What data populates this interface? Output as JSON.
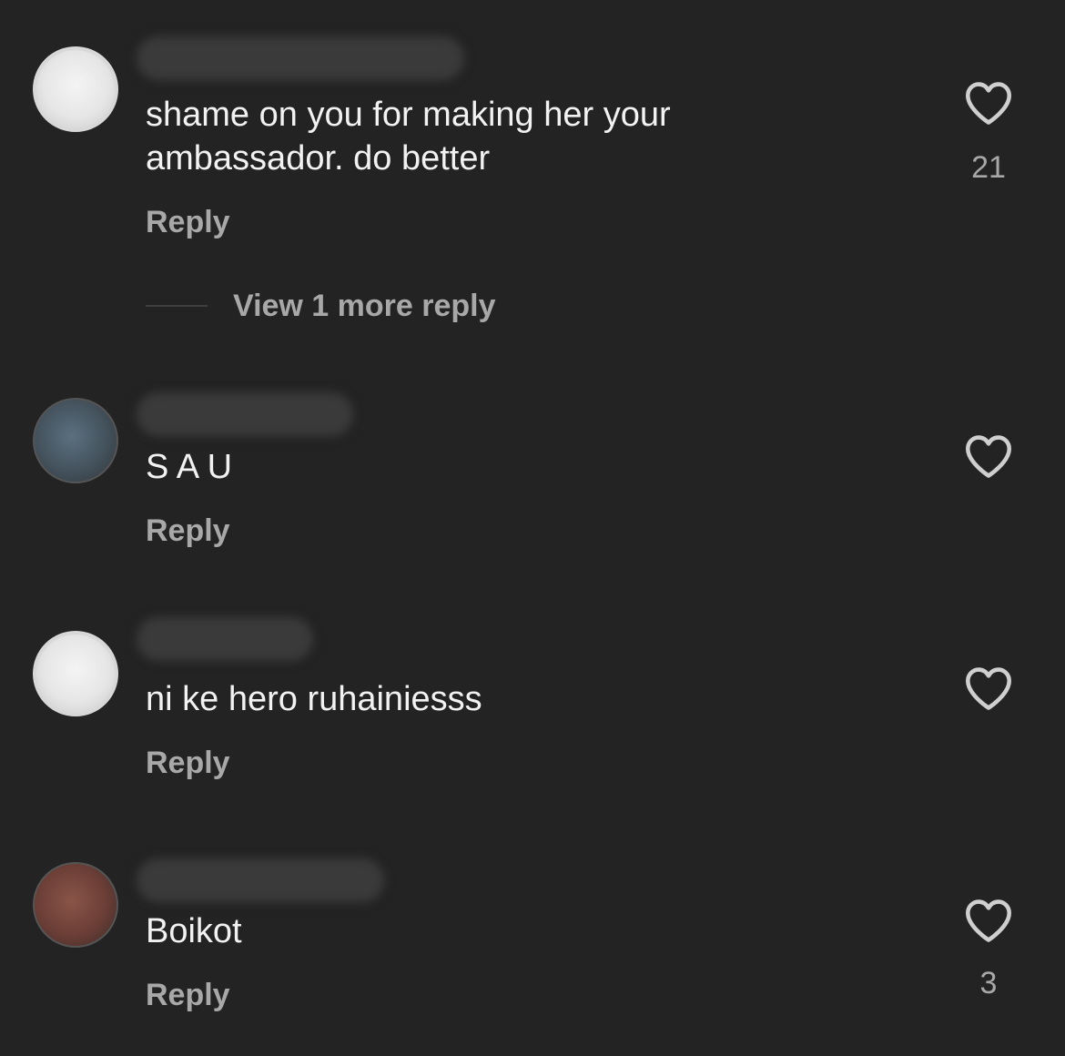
{
  "comments": [
    {
      "text": "shame on you for making her your\nambassador. do better",
      "reply_label": "Reply",
      "like_count": "21",
      "view_replies_label": "View 1 more reply",
      "avatar": "light"
    },
    {
      "text": "S A U",
      "reply_label": "Reply",
      "like_count": "",
      "avatar": "blue"
    },
    {
      "text": "ni ke hero ruhainiesss",
      "reply_label": "Reply",
      "like_count": "",
      "avatar": "light"
    },
    {
      "text": "Boikot",
      "reply_label": "Reply",
      "like_count": "3",
      "avatar": "brown"
    }
  ],
  "icons": {
    "like": "heart-outline-icon"
  },
  "colors": {
    "background": "#232323",
    "text": "#f2f2f2",
    "muted": "#a8a8a8"
  }
}
